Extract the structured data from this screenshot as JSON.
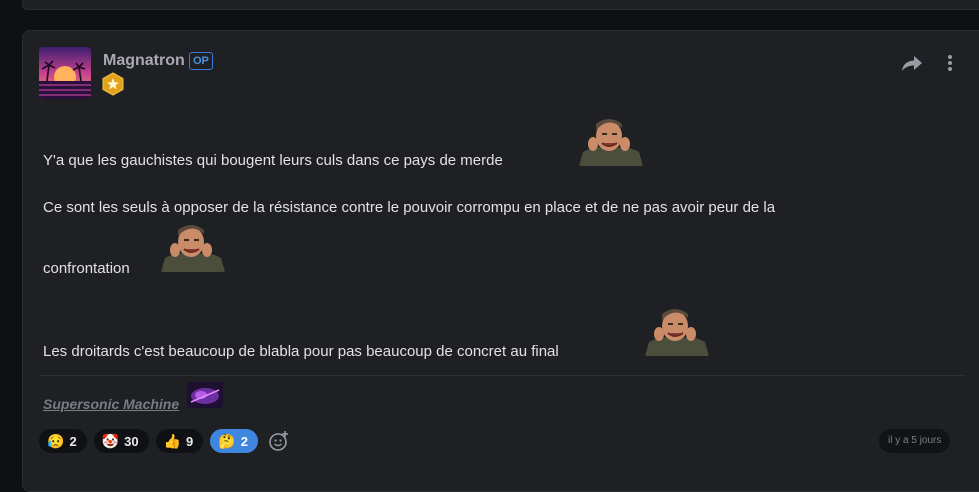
{
  "post": {
    "author": "Magnatron",
    "op_label": "OP",
    "lines": [
      "Y'a que les gauchistes qui bougent leurs culs dans ce pays de merde",
      "Ce sont les seuls à opposer de la résistance contre le pouvoir corrompu en place et de ne pas avoir peur de la",
      "confrontation",
      "Les droitards c'est beaucoup de blabla pour pas beaucoup de concret au final"
    ],
    "signature": "Supersonic Machine",
    "timestamp": "il y a 5 jours"
  },
  "icons": {
    "avatar": "synthwave-palm-sunset-avatar",
    "rank": "gold-star-hexagon-icon",
    "share": "share-arrow-icon",
    "more": "vertical-dots-icon",
    "sticker": "laughing-man-sticker",
    "add_reaction": "add-emoji-icon"
  },
  "reactions": [
    {
      "emoji": "😥",
      "count": "2",
      "active": false
    },
    {
      "emoji": "🤡",
      "count": "30",
      "active": false
    },
    {
      "emoji": "👍",
      "count": "9",
      "active": false
    },
    {
      "emoji": "🤔",
      "count": "2",
      "active": true
    }
  ],
  "colors": {
    "background": "#0f1013",
    "card": "#1f2024",
    "op_badge": "#4a90e2",
    "active_reaction": "#3f86e0"
  }
}
